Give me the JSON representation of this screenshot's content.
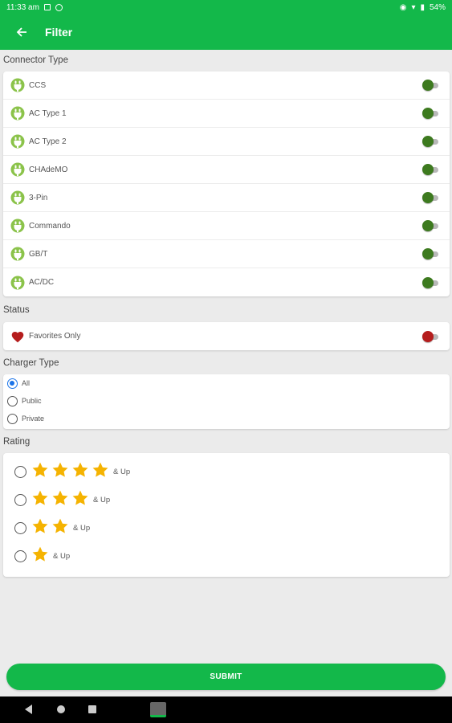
{
  "status_bar": {
    "time": "11:33 am",
    "battery": "54%"
  },
  "header": {
    "title": "Filter"
  },
  "connector_section": {
    "label": "Connector Type",
    "items": [
      {
        "label": "CCS"
      },
      {
        "label": "AC Type 1"
      },
      {
        "label": "AC Type 2"
      },
      {
        "label": "CHAdeMO"
      },
      {
        "label": "3-Pin"
      },
      {
        "label": "Commando"
      },
      {
        "label": "GB/T"
      },
      {
        "label": "AC/DC"
      }
    ]
  },
  "status_section": {
    "label": "Status",
    "favorites_label": "Favorites Only"
  },
  "charger_section": {
    "label": "Charger Type",
    "options": [
      {
        "label": "All",
        "selected": true
      },
      {
        "label": "Public",
        "selected": false
      },
      {
        "label": "Private",
        "selected": false
      }
    ]
  },
  "rating_section": {
    "label": "Rating",
    "options": [
      {
        "stars": 4,
        "suffix": "& Up"
      },
      {
        "stars": 3,
        "suffix": "& Up"
      },
      {
        "stars": 2,
        "suffix": "& Up"
      },
      {
        "stars": 1,
        "suffix": "& Up"
      }
    ]
  },
  "submit_label": "SUBMIT",
  "colors": {
    "brand": "#13b84a",
    "toggle_thumb": "#3d7a1f",
    "favorite": "#b51d1d",
    "star": "#f5b301",
    "radio_selected": "#1a73e8"
  }
}
